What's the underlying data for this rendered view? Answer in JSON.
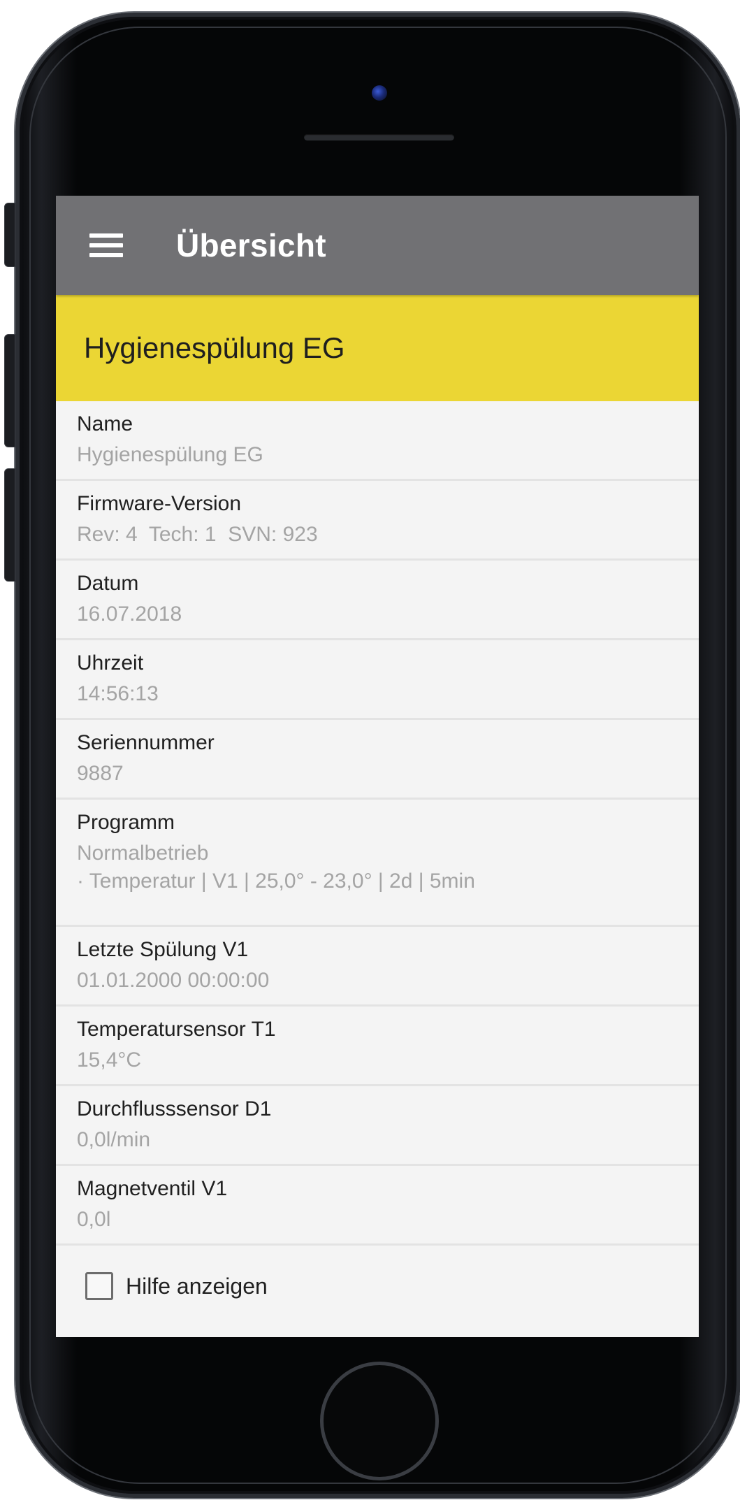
{
  "app_bar": {
    "title": "Übersicht",
    "menu_icon": "hamburger-menu-icon"
  },
  "device": {
    "title": "Hygienespülung EG",
    "banner_color": "#ebd634"
  },
  "colors": {
    "app_bar": "#717174",
    "label_text": "#202020",
    "value_text": "#a4a4a4",
    "screen_background": "#f4f4f4"
  },
  "fields": [
    {
      "label": "Name",
      "value": "Hygienespülung EG"
    },
    {
      "label": "Firmware-Version",
      "value": "Rev: 4  Tech: 1  SVN: 923"
    },
    {
      "label": "Datum",
      "value": "16.07.2018"
    },
    {
      "label": "Uhrzeit",
      "value": "14:56:13"
    },
    {
      "label": "Seriennummer",
      "value": "9887"
    },
    {
      "label": "Programm",
      "value": "Normalbetrieb",
      "sub": "· Temperatur | V1 | 25,0° - 23,0° | 2d | 5min"
    },
    {
      "label": "Letzte Spülung V1",
      "value": "01.01.2000 00:00:00"
    },
    {
      "label": "Temperatursensor T1",
      "value": "15,4°C"
    },
    {
      "label": "Durchflusssensor D1",
      "value": "0,0l/min"
    },
    {
      "label": "Magnetventil V1",
      "value": "0,0l"
    }
  ],
  "help": {
    "label": "Hilfe anzeigen",
    "checked": false
  }
}
